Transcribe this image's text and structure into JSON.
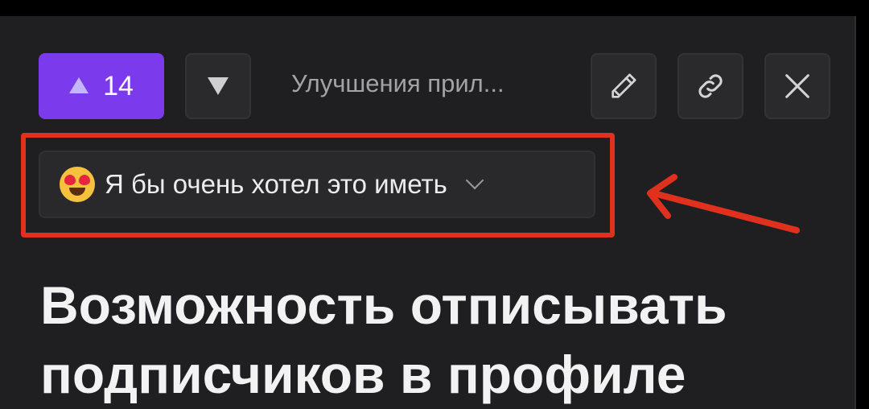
{
  "vote": {
    "count": "14"
  },
  "header": {
    "board_label": "Улучшения прил..."
  },
  "icons": {
    "upvote": "triangle-up-icon",
    "downvote": "triangle-down-icon",
    "edit": "pencil-icon",
    "link": "link-icon",
    "close": "close-icon",
    "status_emoji": "heart-eyes-emoji-icon",
    "dropdown": "chevron-down-icon"
  },
  "status": {
    "label": "Я бы очень хотел это иметь"
  },
  "post": {
    "title": "Возможность отписывать подписчиков в профиле"
  },
  "colors": {
    "accent": "#7c3aed",
    "annotation": "#e0311f",
    "background": "#1f1f21"
  }
}
